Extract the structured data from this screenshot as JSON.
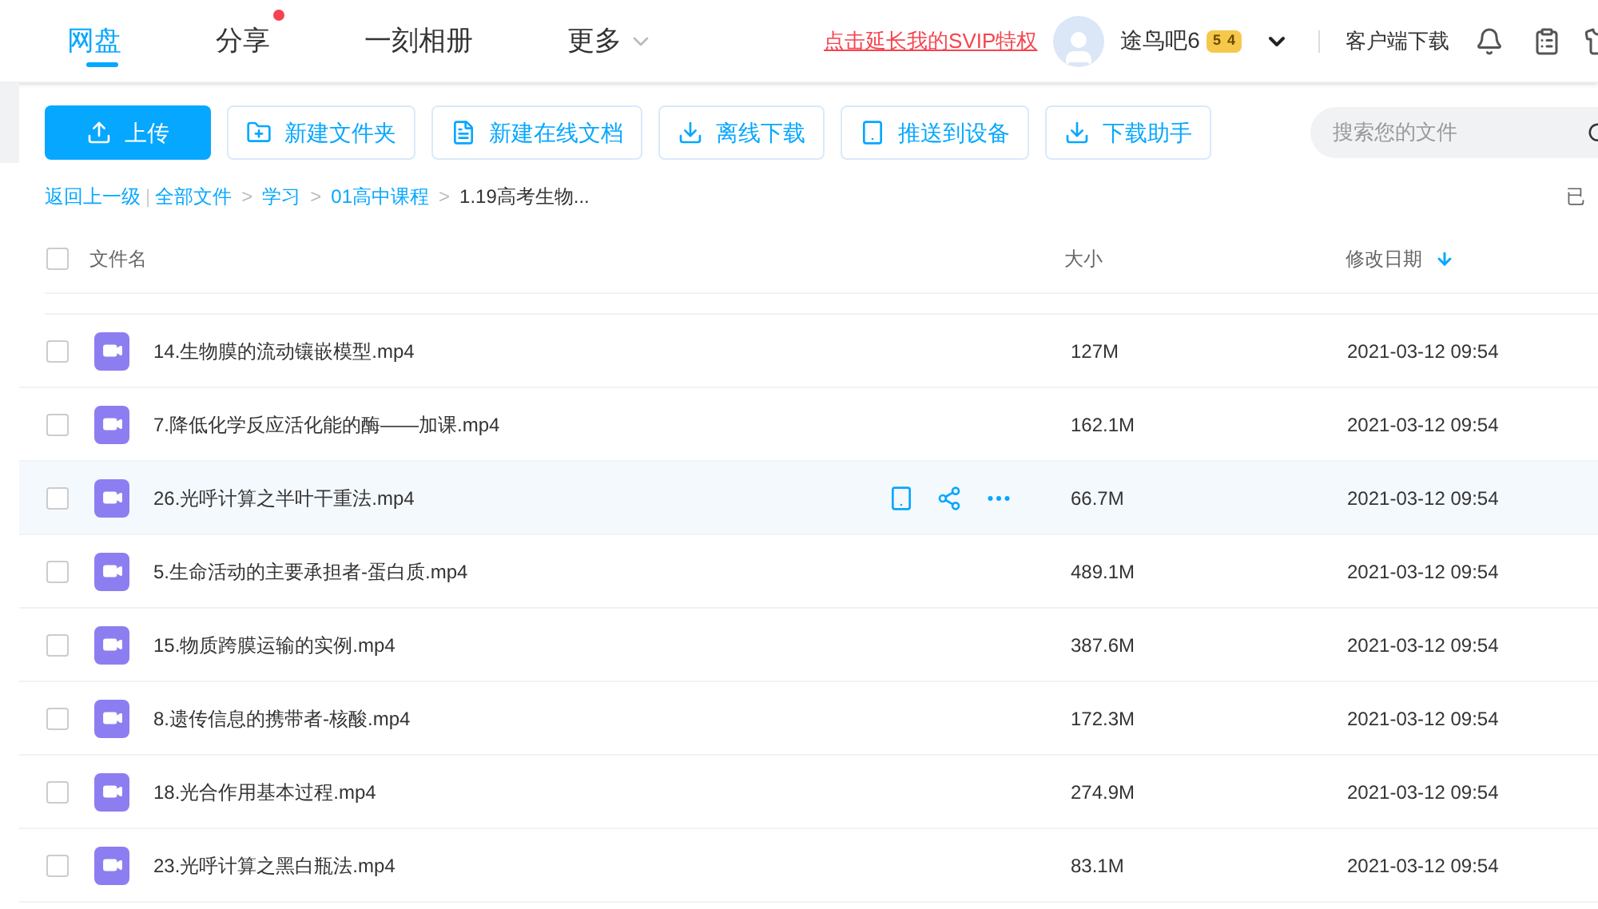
{
  "nav": {
    "tabs": [
      {
        "label": "网盘",
        "selected": true,
        "dot": false,
        "caret": false
      },
      {
        "label": "分享",
        "selected": false,
        "dot": true,
        "caret": false
      },
      {
        "label": "一刻相册",
        "selected": false,
        "dot": false,
        "caret": false
      },
      {
        "label": "更多",
        "selected": false,
        "dot": false,
        "caret": true
      }
    ],
    "promo_link": "点击延长我的SVIP特权",
    "user": {
      "name": "途鸟吧6",
      "badge": [
        "5",
        "4"
      ]
    },
    "client_download": "客户端下载"
  },
  "toolbar": {
    "buttons": [
      {
        "label": "上传",
        "kind": "upload"
      },
      {
        "label": "新建文件夹",
        "kind": "folder"
      },
      {
        "label": "新建在线文档",
        "kind": "doc"
      },
      {
        "label": "离线下载",
        "kind": "download"
      },
      {
        "label": "推送到设备",
        "kind": "device"
      },
      {
        "label": "下载助手",
        "kind": "download"
      }
    ],
    "search": {
      "placeholder": "搜索您的文件"
    }
  },
  "breadcrumb": {
    "back": "返回上一级",
    "divider": "|",
    "items": [
      {
        "label": "全部文件",
        "current": false
      },
      {
        "separator": ">",
        "label": "学习",
        "current": false
      },
      {
        "separator": ">",
        "label": "01高中课程",
        "current": false
      },
      {
        "separator": ">",
        "label": "1.19高考生物...",
        "current": true
      }
    ],
    "status": "已"
  },
  "table": {
    "select_all": {
      "checked": false
    },
    "columns": [
      "文件名",
      "大小",
      "修改日期"
    ],
    "rows": [
      {
        "name": "14.生物膜的流动镶嵌模型.mp4",
        "size": "127M",
        "date": "2021-03-12 09:54",
        "hovered": false
      },
      {
        "name": "7.降低化学反应活化能的酶——加课.mp4",
        "size": "162.1M",
        "date": "2021-03-12 09:54",
        "hovered": false
      },
      {
        "name": "26.光呼计算之半叶干重法.mp4",
        "size": "66.7M",
        "date": "2021-03-12 09:54",
        "hovered": true
      },
      {
        "name": "5.生命活动的主要承担者-蛋白质.mp4",
        "size": "489.1M",
        "date": "2021-03-12 09:54",
        "hovered": false
      },
      {
        "name": "15.物质跨膜运输的实例.mp4",
        "size": "387.6M",
        "date": "2021-03-12 09:54",
        "hovered": false
      },
      {
        "name": "8.遗传信息的携带者-核酸.mp4",
        "size": "172.3M",
        "date": "2021-03-12 09:54",
        "hovered": false
      },
      {
        "name": "18.光合作用基本过程.mp4",
        "size": "274.9M",
        "date": "2021-03-12 09:54",
        "hovered": false
      },
      {
        "name": "23.光呼计算之黑白瓶法.mp4",
        "size": "83.1M",
        "date": "2021-03-12 09:54",
        "hovered": false
      }
    ]
  }
}
